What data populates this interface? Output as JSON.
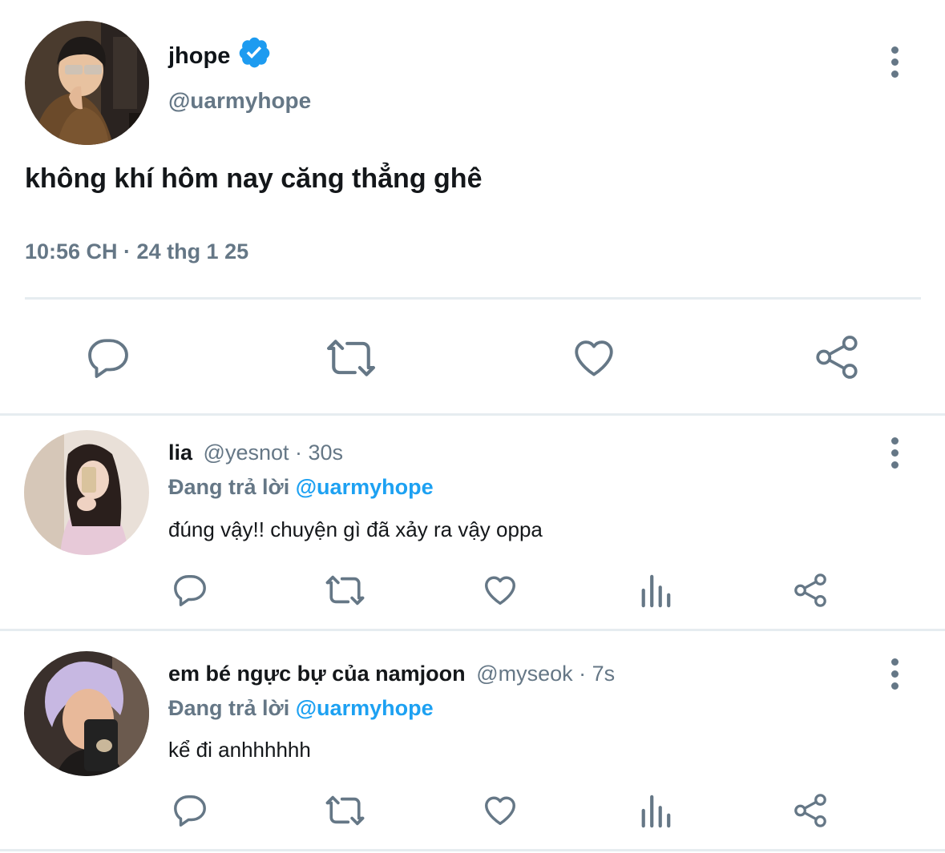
{
  "main_tweet": {
    "name": "jhope",
    "verified": true,
    "handle": "@uarmyhope",
    "text": "không khí hôm nay căng thẳng ghê",
    "timestamp": "10:56 CH · 24 thg 1 25",
    "actions": [
      "reply-icon",
      "retweet-icon",
      "like-icon",
      "share-icon"
    ]
  },
  "replies": [
    {
      "name": "lia",
      "handle": "@yesnot",
      "time": "· 30s",
      "replying_prefix": "Đang trả lời",
      "replying_to": "@uarmyhope",
      "text": "đúng vậy!! chuyện gì đã xảy ra vậy oppa",
      "actions": [
        "reply-icon",
        "retweet-icon",
        "like-icon",
        "analytics-icon",
        "share-icon"
      ]
    },
    {
      "name": "em bé ngực bự của namjoon",
      "handle": "@myseok",
      "time": "· 7s",
      "replying_prefix": "Đang trả lời",
      "replying_to": "@uarmyhope",
      "text": "kể đi anhhhhhh",
      "actions": [
        "reply-icon",
        "retweet-icon",
        "like-icon",
        "analytics-icon",
        "share-icon"
      ]
    }
  ],
  "colors": {
    "verified_blue": "#1d9bf0",
    "mention_blue": "#1da1f2",
    "icon_gray": "#657786",
    "divider": "#e6ecf0"
  }
}
